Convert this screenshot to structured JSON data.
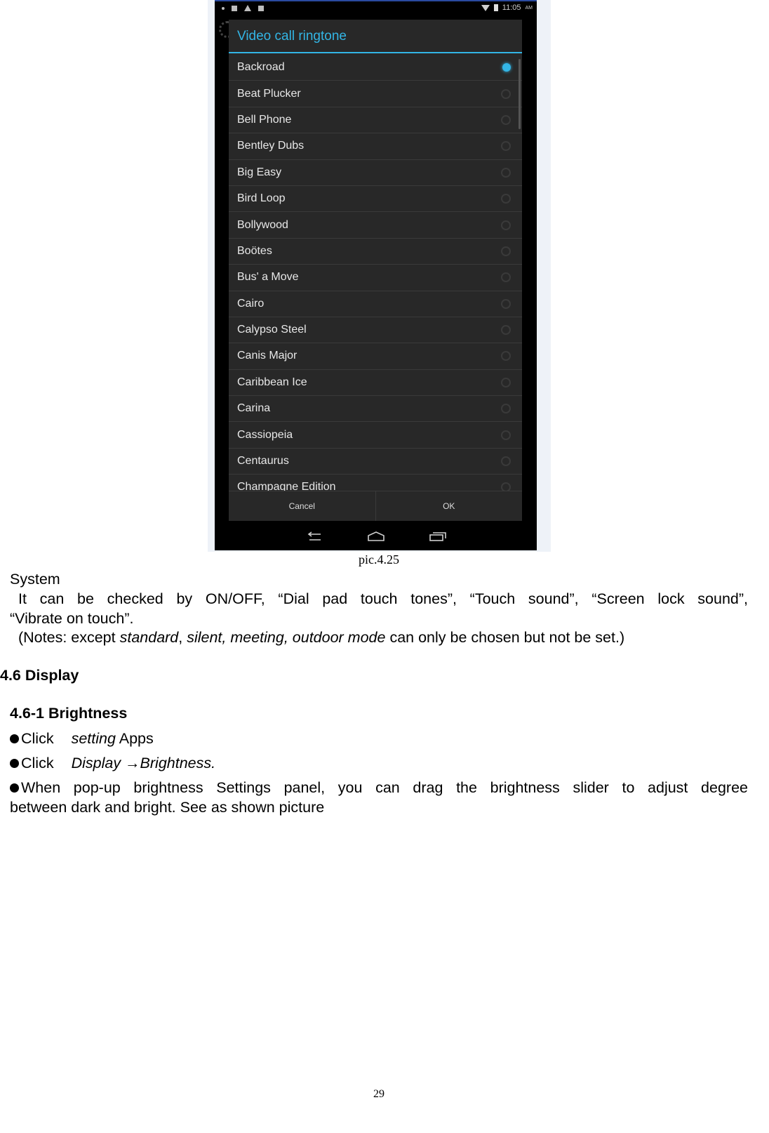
{
  "screenshot": {
    "status_bar": {
      "time": "11:05",
      "ampm": "AM"
    },
    "dialog": {
      "title": "Video call ringtone",
      "accent_color": "#33b5e5",
      "selected_index": 0,
      "items": [
        "Backroad",
        "Beat Plucker",
        "Bell Phone",
        "Bentley Dubs",
        "Big Easy",
        "Bird Loop",
        "Bollywood",
        "Boötes",
        "Bus' a Move",
        "Cairo",
        "Calypso Steel",
        "Canis Major",
        "Caribbean Ice",
        "Carina",
        "Cassiopeia",
        "Centaurus",
        "Champagne Edition"
      ],
      "cancel_label": "Cancel",
      "ok_label": "OK"
    }
  },
  "caption": "pic.4.25",
  "system": {
    "heading": "System",
    "line1": "It can be checked by ON/OFF, “Dial pad touch tones”, “Touch sound”, “Screen lock sound”,",
    "line2": "“Vibrate on touch”.",
    "notes_prefix": "(Notes: except ",
    "notes_italic1": "standard",
    "notes_sep": ", ",
    "notes_italic2": "silent, meeting, outdoor mode",
    "notes_suffix": " can only be chosen but not be set.)"
  },
  "section": {
    "heading": "4.6 Display",
    "subheading": "4.6-1 Brightness",
    "step1_prefix": "Click",
    "step1_italic": "setting",
    "step1_suffix": " Apps",
    "step2_prefix": "Click",
    "step2_italic": "Display →Brightness.",
    "step3_line1": "When pop-up brightness Settings panel, you can drag the brightness slider to adjust degree",
    "step3_line2": "between dark and bright. See as shown picture"
  },
  "page_number": "29"
}
